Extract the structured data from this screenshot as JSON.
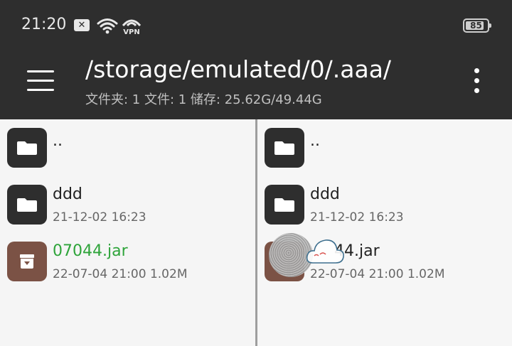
{
  "status": {
    "time": "21:20",
    "notification_icon": "x-badge-icon",
    "wifi_icon": "wifi-icon",
    "vpn_label": "VPN",
    "battery_level": 85,
    "battery_text": "85"
  },
  "toolbar": {
    "menu_icon": "hamburger-icon",
    "path": "/storage/emulated/0/.aaa/",
    "info": "文件夹: 1  文件: 1  储存: 25.62G/49.44G",
    "more_icon": "more-vert-icon"
  },
  "left_pane": {
    "items": [
      {
        "name": "..",
        "meta": "",
        "icon": "folder-icon"
      },
      {
        "name": "ddd",
        "meta": "21-12-02 16:23",
        "icon": "folder-icon"
      },
      {
        "name": "07044.jar",
        "meta": "22-07-04 21:00  1.02M",
        "icon": "archive-icon",
        "color": "#2ea43a"
      }
    ]
  },
  "right_pane": {
    "items": [
      {
        "name": "..",
        "meta": "",
        "icon": "folder-icon"
      },
      {
        "name": "ddd",
        "meta": "21-12-02 16:23",
        "icon": "folder-icon"
      },
      {
        "name": "44.jar",
        "meta": "22-07-04 21:00  1.02M",
        "icon": "archive-icon"
      }
    ]
  },
  "colors": {
    "bar": "#2e2e2e",
    "archive": "#7b5245",
    "highlight": "#2ea43a"
  }
}
